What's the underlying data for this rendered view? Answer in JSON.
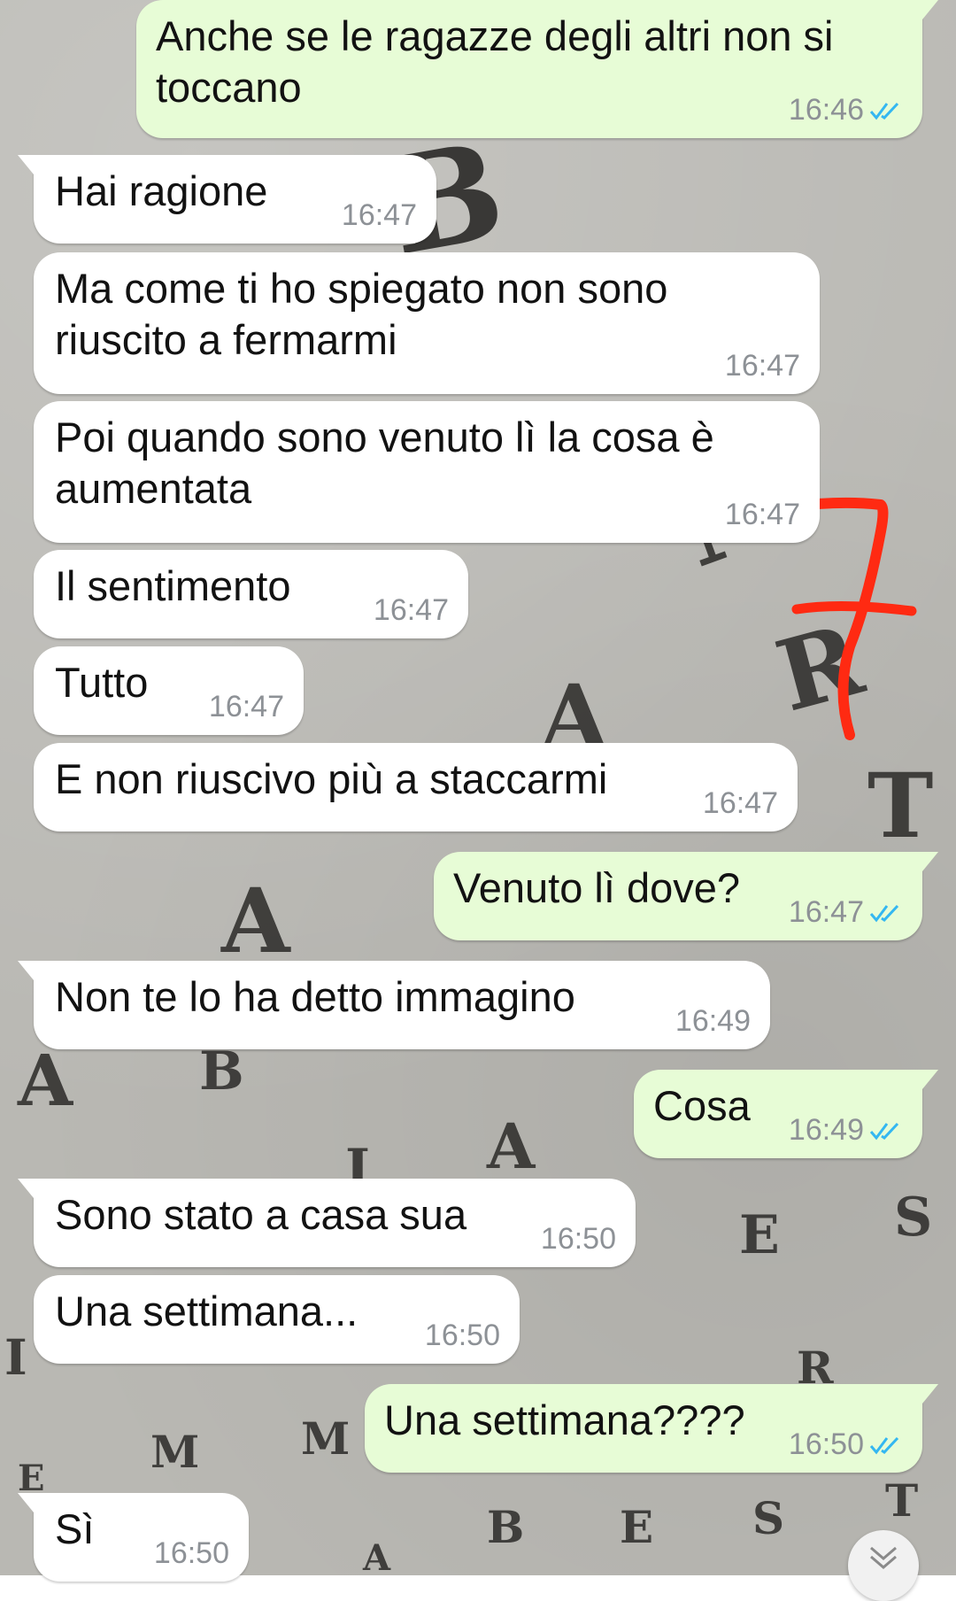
{
  "chat": {
    "messages": [
      {
        "dir": "out",
        "text": "Anche se le ragazze degli altri non si toccano",
        "lines": [
          "Anche se le ragazze degli altri non si",
          "toccano"
        ],
        "time": "16:46",
        "read": true
      },
      {
        "dir": "in",
        "text": "Hai ragione",
        "lines": [
          "Hai ragione"
        ],
        "time": "16:47"
      },
      {
        "dir": "in",
        "text": "Ma come ti ho spiegato non sono riuscito a fermarmi",
        "lines": [
          "Ma come ti ho spiegato non sono",
          "riuscito a fermarmi"
        ],
        "time": "16:47"
      },
      {
        "dir": "in",
        "text": "Poi quando sono venuto lì la cosa è aumentata",
        "lines": [
          "Poi quando sono venuto lì la cosa è",
          "aumentata"
        ],
        "time": "16:47"
      },
      {
        "dir": "in",
        "text": "Il sentimento",
        "lines": [
          "Il sentimento"
        ],
        "time": "16:47"
      },
      {
        "dir": "in",
        "text": "Tutto",
        "lines": [
          "Tutto"
        ],
        "time": "16:47"
      },
      {
        "dir": "in",
        "text": "E non riuscivo più a staccarmi",
        "lines": [
          "E non riuscivo più a staccarmi"
        ],
        "time": "16:47"
      },
      {
        "dir": "out",
        "text": "Venuto lì dove?",
        "lines": [
          "Venuto lì dove?"
        ],
        "time": "16:47",
        "read": true
      },
      {
        "dir": "in",
        "text": "Non te lo ha detto immagino",
        "lines": [
          "Non te lo ha detto immagino"
        ],
        "time": "16:49"
      },
      {
        "dir": "out",
        "text": "Cosa",
        "lines": [
          "Cosa"
        ],
        "time": "16:49",
        "read": true
      },
      {
        "dir": "in",
        "text": "Sono stato a casa sua",
        "lines": [
          "Sono stato a casa sua"
        ],
        "time": "16:50"
      },
      {
        "dir": "in",
        "text": "Una settimana...",
        "lines": [
          "Una settimana..."
        ],
        "time": "16:50"
      },
      {
        "dir": "out",
        "text": "Una settimana????",
        "lines": [
          "Una settimana????"
        ],
        "time": "16:50",
        "read": true
      },
      {
        "dir": "in",
        "text": "Sì",
        "lines": [
          "Sì"
        ],
        "time": "16:50"
      }
    ]
  },
  "colors": {
    "incoming_bubble": "#ffffff",
    "outgoing_bubble": "#e7fcd6",
    "read_ticks": "#34b7f1",
    "timestamp": "#8d9196",
    "annotation": "#ff2a12"
  },
  "icons": {
    "read_receipt": "double-check-icon",
    "scroll_down": "double-chevron-down-icon"
  }
}
